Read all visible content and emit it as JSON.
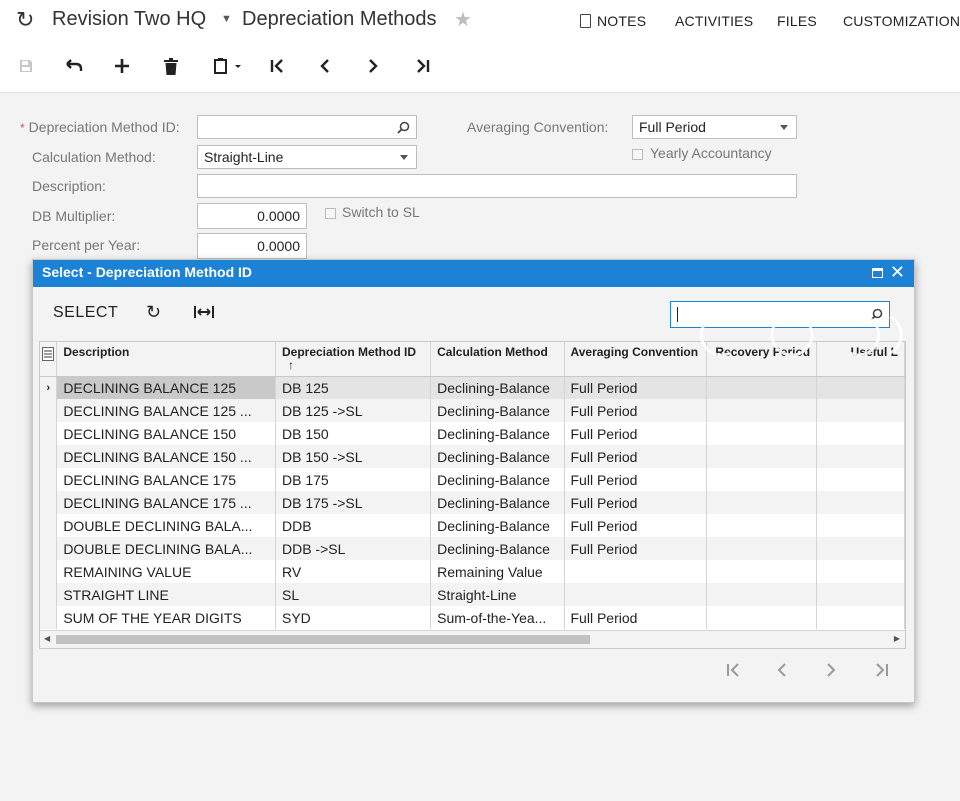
{
  "header": {
    "company": "Revision Two HQ",
    "screen_title": "Depreciation Methods",
    "links": {
      "notes": "NOTES",
      "activities": "ACTIVITIES",
      "files": "FILES",
      "customization": "CUSTOMIZATION"
    }
  },
  "form": {
    "method_id_label": "Depreciation Method ID:",
    "method_id_value": "",
    "calc_method_label": "Calculation Method:",
    "calc_method_value": "Straight-Line",
    "description_label": "Description:",
    "description_value": "",
    "db_multiplier_label": "DB Multiplier:",
    "db_multiplier_value": "0.0000",
    "switch_to_sl_label": "Switch to SL",
    "percent_per_year_label": "Percent per Year:",
    "percent_per_year_value": "0.0000",
    "averaging_convention_label": "Averaging Convention:",
    "averaging_convention_value": "Full Period",
    "yearly_accountancy_label": "Yearly Accountancy"
  },
  "dialog": {
    "title": "Select - Depreciation Method ID",
    "select_label": "SELECT",
    "search_value": "",
    "columns": [
      "Description",
      "Depreciation Method ID",
      "Calculation Method",
      "Averaging Convention",
      "Recovery Period",
      "Useful L"
    ],
    "rows": [
      [
        "DECLINING BALANCE 125",
        "DB 125",
        "Declining-Balance",
        "Full Period"
      ],
      [
        "DECLINING BALANCE 125 ...",
        "DB 125 ->SL",
        "Declining-Balance",
        "Full Period"
      ],
      [
        "DECLINING BALANCE 150",
        "DB 150",
        "Declining-Balance",
        "Full Period"
      ],
      [
        "DECLINING BALANCE 150 ...",
        "DB 150 ->SL",
        "Declining-Balance",
        "Full Period"
      ],
      [
        "DECLINING BALANCE 175",
        "DB 175",
        "Declining-Balance",
        "Full Period"
      ],
      [
        "DECLINING BALANCE 175 ...",
        "DB 175 ->SL",
        "Declining-Balance",
        "Full Period"
      ],
      [
        "DOUBLE DECLINING BALA...",
        "DDB",
        "Declining-Balance",
        "Full Period"
      ],
      [
        "DOUBLE DECLINING BALA...",
        "DDB ->SL",
        "Declining-Balance",
        "Full Period"
      ],
      [
        "REMAINING VALUE",
        "RV",
        "Remaining Value",
        ""
      ],
      [
        "STRAIGHT LINE",
        "SL",
        "Straight-Line",
        ""
      ],
      [
        "SUM OF THE YEAR DIGITS",
        "SYD",
        "Sum-of-the-Yea...",
        "Full Period"
      ]
    ],
    "selected_row_marker": "›"
  },
  "colors": {
    "accent": "#1b82d6",
    "form_bg": "#f3f3f3",
    "required": "#d9534f"
  }
}
